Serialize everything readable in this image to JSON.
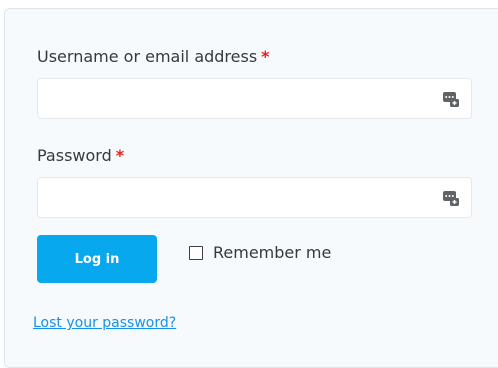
{
  "login_form": {
    "username": {
      "label": "Username or email address",
      "required_marker": "*",
      "value": "",
      "password_manager_icon": "password-manager-icon"
    },
    "password": {
      "label": "Password",
      "required_marker": "*",
      "value": "",
      "password_manager_icon": "password-manager-icon"
    },
    "login_button_label": "Log in",
    "remember_me": {
      "label": "Remember me",
      "checked": false
    },
    "lost_password_link": "Lost your password?"
  },
  "colors": {
    "accent": "#08a8ee",
    "required": "#e2201c",
    "link": "#1592e6",
    "panel_background": "#f7fafc"
  }
}
